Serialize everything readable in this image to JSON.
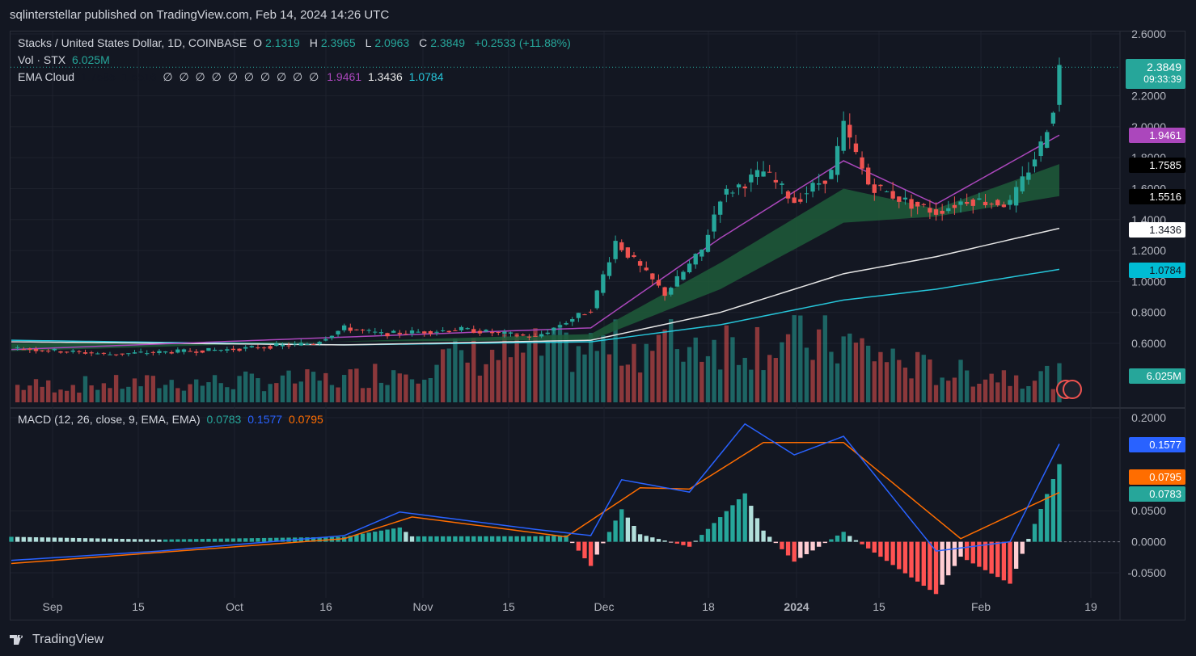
{
  "header": {
    "publisher_line": "sqlinterstellar published on TradingView.com, Feb 14, 2024 14:26 UTC"
  },
  "legend": {
    "symbol": "Stacks / United States Dollar, 1D, COINBASE",
    "o_label": "O",
    "o_value": "2.1319",
    "h_label": "H",
    "h_value": "2.3965",
    "l_label": "L",
    "l_value": "2.0963",
    "c_label": "C",
    "c_value": "2.3849",
    "change": "+0.2533 (+11.88%)",
    "vol_label": "Vol · STX",
    "vol_value": "6.025M",
    "ema_label": "EMA Cloud",
    "ema_v1": "1.7585",
    "ema_v2": "1.5516",
    "ema_empty": "∅ ∅ ∅ ∅ ∅ ∅ ∅ ∅ ∅ ∅",
    "ema_v3": "1.9461",
    "ema_v4": "1.3436",
    "ema_v5": "1.0784",
    "macd_label": "MACD (12, 26, close, 9, EMA, EMA)",
    "macd_hist": "0.0783",
    "macd_line": "0.1577",
    "macd_signal": "0.0795"
  },
  "price_tags": {
    "last": "2.3849",
    "countdown": "09:33:39",
    "ema_fast": "1.9461",
    "cloud_top": "1.7585",
    "cloud_bottom": "1.5516",
    "ema_white": "1.3436",
    "ema_cyan": "1.0784",
    "volume": "6.025M",
    "macd_line": "0.1577",
    "macd_signal": "0.0795",
    "macd_hist": "0.0783"
  },
  "footer": {
    "brand": "TradingView"
  },
  "colors": {
    "up": "#26a69a",
    "down": "#ef5350",
    "ema_fast": "#ab47bc",
    "ema_white": "#e6e6e6",
    "ema_cyan": "#26c6da",
    "cloud_bull": "#1e5c3a",
    "cloud_bear": "#7a1f22",
    "macd": "#2962ff",
    "signal": "#ff6d00"
  },
  "chart_data": {
    "type": "candlestick",
    "title": "Stacks / United States Dollar, 1D, COINBASE",
    "price_axis": {
      "ticks": [
        "2.6000",
        "2.2000",
        "2.0000",
        "1.8000",
        "1.6000",
        "1.4000",
        "1.2000",
        "1.0000",
        "0.8000",
        "0.6000"
      ],
      "ylim": [
        0.5,
        2.6
      ]
    },
    "time_axis": {
      "ticks": [
        "Sep",
        "15",
        "Oct",
        "16",
        "Nov",
        "15",
        "Dec",
        "18",
        "2024",
        "15",
        "Feb",
        "19"
      ]
    },
    "ohlc_sample": {
      "open": 2.1319,
      "high": 2.3965,
      "low": 2.0963,
      "close": 2.3849
    },
    "close_anchors": [
      {
        "date": "2023-08-27",
        "close": 0.57
      },
      {
        "date": "2023-09-12",
        "close": 0.53
      },
      {
        "date": "2023-10-01",
        "close": 0.56
      },
      {
        "date": "2023-10-15",
        "close": 0.6
      },
      {
        "date": "2023-10-20",
        "close": 0.7
      },
      {
        "date": "2023-10-26",
        "close": 0.66
      },
      {
        "date": "2023-11-08",
        "close": 0.69
      },
      {
        "date": "2023-11-20",
        "close": 0.64
      },
      {
        "date": "2023-11-29",
        "close": 0.82
      },
      {
        "date": "2023-12-03",
        "close": 1.26
      },
      {
        "date": "2023-12-11",
        "close": 0.92
      },
      {
        "date": "2023-12-17",
        "close": 1.2
      },
      {
        "date": "2023-12-20",
        "close": 1.55
      },
      {
        "date": "2023-12-27",
        "close": 1.71
      },
      {
        "date": "2024-01-01",
        "close": 1.52
      },
      {
        "date": "2024-01-07",
        "close": 1.7
      },
      {
        "date": "2024-01-09",
        "close": 2.0
      },
      {
        "date": "2024-01-13",
        "close": 1.63
      },
      {
        "date": "2024-01-20",
        "close": 1.5
      },
      {
        "date": "2024-01-24",
        "close": 1.45
      },
      {
        "date": "2024-01-29",
        "close": 1.53
      },
      {
        "date": "2024-02-05",
        "close": 1.5
      },
      {
        "date": "2024-02-10",
        "close": 1.88
      },
      {
        "date": "2024-02-12",
        "close": 2.13
      },
      {
        "date": "2024-02-13",
        "close": 2.38
      }
    ],
    "ema_fast_anchors": [
      {
        "date": "2023-08-27",
        "value": 0.56
      },
      {
        "date": "2023-11-29",
        "value": 0.7
      },
      {
        "date": "2023-12-20",
        "value": 1.28
      },
      {
        "date": "2024-01-09",
        "value": 1.78
      },
      {
        "date": "2024-01-24",
        "value": 1.5
      },
      {
        "date": "2024-02-13",
        "value": 1.9461
      }
    ],
    "cloud_top_anchors": [
      {
        "date": "2023-08-27",
        "value": 0.55
      },
      {
        "date": "2023-11-29",
        "value": 0.66
      },
      {
        "date": "2023-12-20",
        "value": 1.12
      },
      {
        "date": "2024-01-09",
        "value": 1.6
      },
      {
        "date": "2024-01-24",
        "value": 1.47
      },
      {
        "date": "2024-02-13",
        "value": 1.7585
      }
    ],
    "cloud_bottom_anchors": [
      {
        "date": "2023-08-27",
        "value": 0.6
      },
      {
        "date": "2023-11-29",
        "value": 0.62
      },
      {
        "date": "2023-12-20",
        "value": 0.95
      },
      {
        "date": "2024-01-09",
        "value": 1.38
      },
      {
        "date": "2024-01-24",
        "value": 1.42
      },
      {
        "date": "2024-02-13",
        "value": 1.5516
      }
    ],
    "ema_white_anchors": [
      {
        "date": "2023-08-27",
        "value": 0.61
      },
      {
        "date": "2023-10-20",
        "value": 0.59
      },
      {
        "date": "2023-11-29",
        "value": 0.62
      },
      {
        "date": "2023-12-20",
        "value": 0.8
      },
      {
        "date": "2024-01-09",
        "value": 1.05
      },
      {
        "date": "2024-01-24",
        "value": 1.16
      },
      {
        "date": "2024-02-13",
        "value": 1.3436
      }
    ],
    "ema_cyan_anchors": [
      {
        "date": "2023-08-27",
        "value": 0.62
      },
      {
        "date": "2023-10-20",
        "value": 0.59
      },
      {
        "date": "2023-11-29",
        "value": 0.61
      },
      {
        "date": "2023-12-20",
        "value": 0.72
      },
      {
        "date": "2024-01-09",
        "value": 0.88
      },
      {
        "date": "2024-01-24",
        "value": 0.95
      },
      {
        "date": "2024-02-13",
        "value": 1.0784
      }
    ],
    "volume_anchors": [
      {
        "date": "2023-08-27",
        "value": 0.25
      },
      {
        "date": "2023-10-20",
        "value": 0.35
      },
      {
        "date": "2023-11-08",
        "value": 0.7
      },
      {
        "date": "2023-12-03",
        "value": 0.85
      },
      {
        "date": "2023-12-20",
        "value": 0.95
      },
      {
        "date": "2024-01-09",
        "value": 0.9
      },
      {
        "date": "2024-01-24",
        "value": 0.45
      },
      {
        "date": "2024-02-13",
        "value": 0.4
      }
    ],
    "macd": {
      "ticks": [
        "0.2000",
        "0.0500",
        "0.0000",
        "-0.0500"
      ],
      "ylim": [
        -0.07,
        0.21
      ],
      "macd_anchors": [
        {
          "date": "2023-08-27",
          "value": -0.03
        },
        {
          "date": "2023-09-20",
          "value": -0.015
        },
        {
          "date": "2023-10-20",
          "value": 0.01
        },
        {
          "date": "2023-10-29",
          "value": 0.048
        },
        {
          "date": "2023-11-20",
          "value": 0.02
        },
        {
          "date": "2023-11-29",
          "value": 0.01
        },
        {
          "date": "2023-12-04",
          "value": 0.1
        },
        {
          "date": "2023-12-15",
          "value": 0.08
        },
        {
          "date": "2023-12-24",
          "value": 0.19
        },
        {
          "date": "2024-01-01",
          "value": 0.14
        },
        {
          "date": "2024-01-09",
          "value": 0.17
        },
        {
          "date": "2024-01-24",
          "value": -0.015
        },
        {
          "date": "2024-02-05",
          "value": 0.0
        },
        {
          "date": "2024-02-13",
          "value": 0.1577
        }
      ],
      "signal_anchors": [
        {
          "date": "2023-08-27",
          "value": -0.035
        },
        {
          "date": "2023-10-20",
          "value": 0.005
        },
        {
          "date": "2023-10-31",
          "value": 0.04
        },
        {
          "date": "2023-11-25",
          "value": 0.008
        },
        {
          "date": "2023-12-07",
          "value": 0.087
        },
        {
          "date": "2023-12-15",
          "value": 0.085
        },
        {
          "date": "2023-12-27",
          "value": 0.16
        },
        {
          "date": "2024-01-09",
          "value": 0.16
        },
        {
          "date": "2024-01-28",
          "value": 0.005
        },
        {
          "date": "2024-02-13",
          "value": 0.0795
        }
      ],
      "hist_latest": 0.0783
    }
  }
}
